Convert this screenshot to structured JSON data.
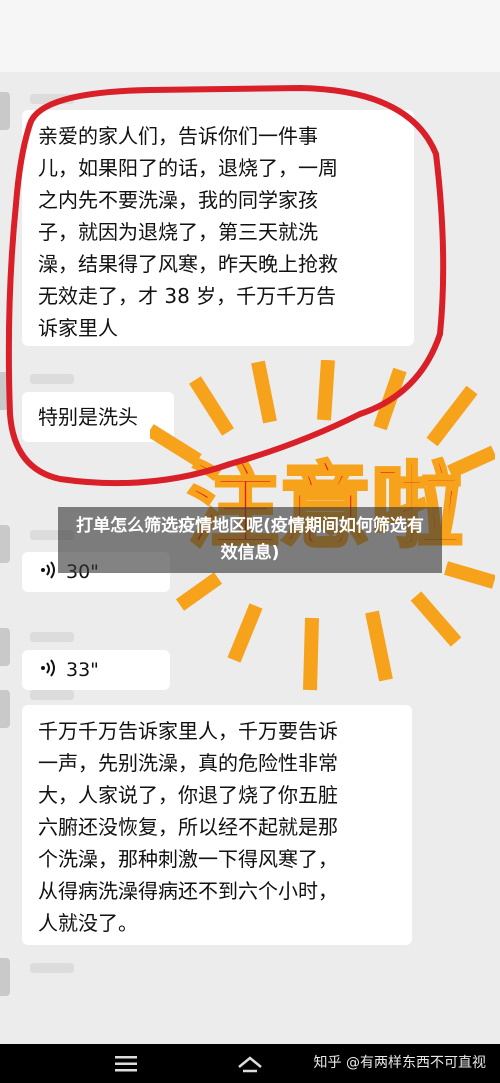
{
  "messages": {
    "first": "亲爱的家人们，告诉你们一件事\n儿，如果阳了的话，退烧了，一周\n之内先不要洗澡，我的同学家孩\n子，就因为退烧了，第三天就洗\n澡，结果得了风寒，昨天晚上抢救\n无效走了，才 38 岁，千万千万告\n诉家里人",
    "second": "特别是洗头",
    "voice1": "30\"",
    "voice2": "33\"",
    "third": "千万千万告诉家里人，千万要告诉\n一声，先别洗澡，真的危险性非常\n大，人家说了，你退了烧了你五脏\n六腑还没恢复，所以经不起就是那\n个洗澡，那种刺激一下得风寒了，\n从得病洗澡得病还不到六个小时，\n人就没了。"
  },
  "sticker": {
    "text": "注意啦",
    "color": "#e8141c",
    "ray_color": "#f6a21a"
  },
  "highlight_color": "#d91f28",
  "caption": "打单怎么筛选疫情地区呢(疫情期间如何筛选有效信息)",
  "watermark": "知乎 @有两样东西不可直视",
  "icons": {
    "voice": "voice-wave-icon",
    "menu": "menu-icon",
    "home": "home-icon",
    "back": "back-icon"
  }
}
